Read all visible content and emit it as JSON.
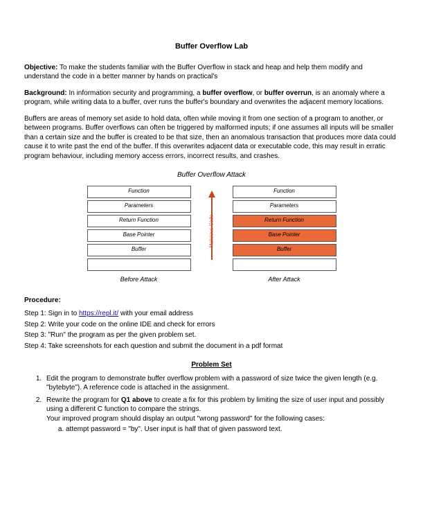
{
  "title": "Buffer Overflow Lab",
  "objective": {
    "label": "Objective:",
    "text": " To make the students familiar with the Buffer Overflow in stack and heap and help them modify and understand the code in a better manner by hands on practical's"
  },
  "background": {
    "label": " Background:",
    "text1a": " In information security and programming, a ",
    "text1b": "buffer overflow",
    "text1c": ", or ",
    "text1d": "buffer overrun",
    "text1e": ", is an anomaly where a program, while writing data to a buffer, over runs the buffer's boundary and  overwrites the adjacent  memory  locations.",
    "text2": "Buffers are areas of memory set aside to hold data, often while moving it from one section of a program to another, or between programs. Buffer overflows can often be triggered by malformed inputs; if one assumes all inputs will be smaller than a certain size and the buffer is created to be that size, then an anomalous transaction that produces more data could cause it to write past the end of the buffer. If this overwrites adjacent data or executable code, this may result in erratic program behaviour, including memory access errors, incorrect results, and crashes."
  },
  "diagram": {
    "title": "Buffer Overflow Attack",
    "arrow_label": "Malicious Code",
    "left": {
      "cells": [
        "Function",
        "Parameters",
        "Return Function",
        "Base Pointer",
        "Buffer",
        ""
      ],
      "caption": "Before Attack"
    },
    "right": {
      "cells": [
        "Function",
        "Parameters",
        "Return Function",
        "Base Pointer",
        "Buffer",
        ""
      ],
      "corrupt": [
        false,
        false,
        true,
        true,
        true,
        false
      ],
      "caption": "After Attack"
    }
  },
  "procedure": {
    "label": "Procedure:",
    "step1a": "Step 1: Sign in to ",
    "step1link": "https://repl.it/",
    "step1b": " with your email address",
    "step2": "Step 2: Write your code on the online IDE and check for errors",
    "step3": "Step 3: \"Run\" the program as per the given problem set.",
    "step4": "Step 4: Take screenshots for each question and submit the document in a pdf format"
  },
  "problem_set": {
    "title": "Problem Set",
    "q1": "Edit the program to demonstrate buffer overflow problem with a password of size twice the given length (e.g. \"bytebyte\").  A reference code is attached in the assignment.",
    "q2a": "Rewrite the program for ",
    "q2b": "Q1 above",
    "q2c": " to create a fix for this problem by limiting the size of user input and possibly using a different C function to compare the strings.",
    "q2d": "Your improved program should display an output \"wrong password\" for the following cases:",
    "q2_sub_a": "attempt password = \"by\". User input is half that of given password text."
  }
}
